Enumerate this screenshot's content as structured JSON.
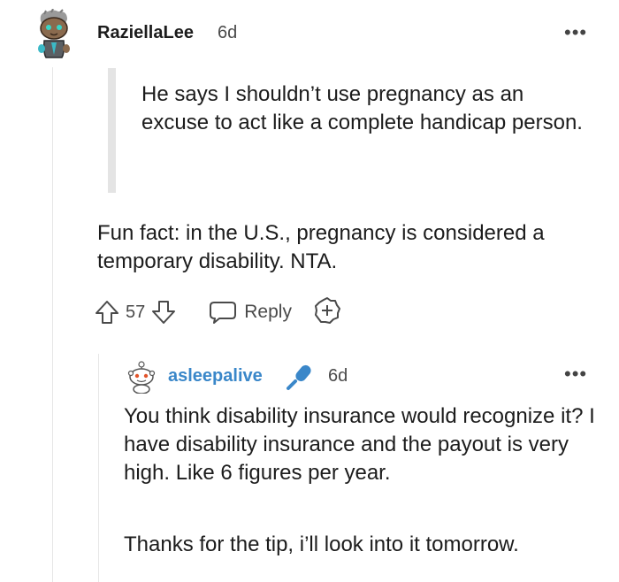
{
  "comment": {
    "username": "RaziellaLee",
    "time": "6d",
    "more": "•••",
    "quote": "He says I shouldn’t use pregnancy as an excuse to act like a complete handicap person.",
    "body": "Fun fact: in the U.S., pregnancy is considered a temporary disability. NTA.",
    "votes": "57",
    "reply_label": "Reply"
  },
  "reply": {
    "username": "asleepalive",
    "time": "6d",
    "more": "•••",
    "paragraph1": "You think disability insurance would recognize it? I have disability insurance and the payout is very high. Like 6 figures per year.",
    "paragraph2": "Thanks for the tip, i’ll look into it tomorrow."
  },
  "colors": {
    "username_link": "#3a87c9",
    "mic_badge": "#3a87c9",
    "quote_bar": "#e4e4e4"
  }
}
